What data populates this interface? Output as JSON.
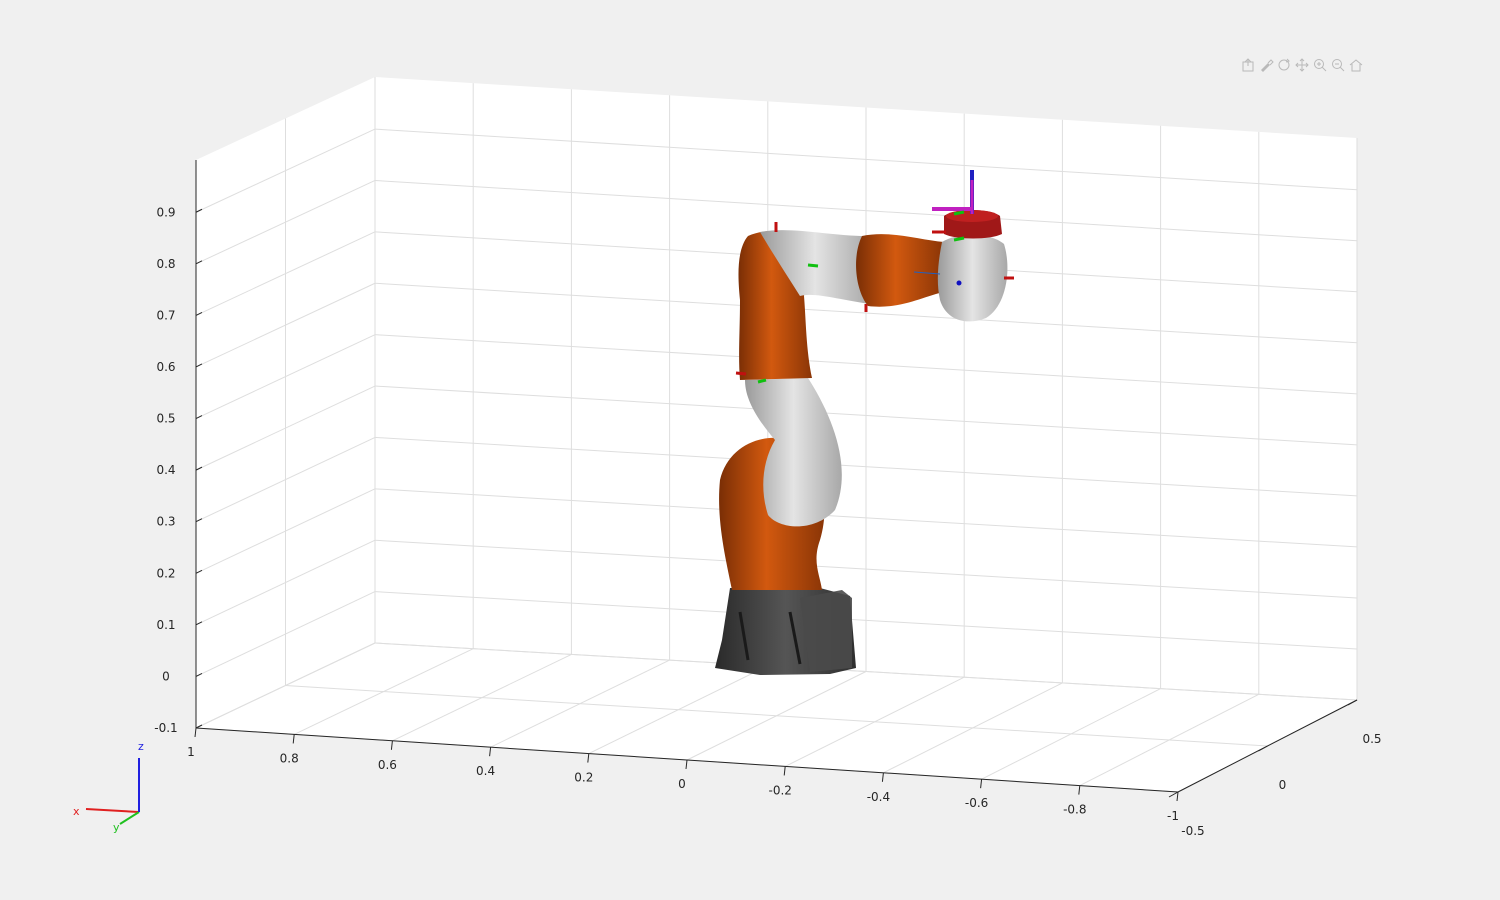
{
  "axes": {
    "x_ticks": [
      "1",
      "0.8",
      "0.6",
      "0.4",
      "0.2",
      "0",
      "-0.2",
      "-0.4",
      "-0.6",
      "-0.8",
      "-1"
    ],
    "y_ticks": [
      "0.5",
      "0",
      "-0.5"
    ],
    "z_ticks": [
      "0.9",
      "0.8",
      "0.7",
      "0.6",
      "0.5",
      "0.4",
      "0.3",
      "0.2",
      "0.1",
      "0",
      "-0.1"
    ],
    "grid": true,
    "background": "#ffffff",
    "grid_color": "#dedede"
  },
  "triad": {
    "x_label": "x",
    "y_label": "y",
    "z_label": "z"
  },
  "toolbar": {
    "icons": [
      "export-icon",
      "brush-icon",
      "rotate-icon",
      "pan-icon",
      "zoom-in-icon",
      "zoom-out-icon",
      "home-icon"
    ]
  },
  "colors": {
    "robot_orange": "#c2500e",
    "robot_gray": "#c8c8c8",
    "base_dark": "#3a3a3a",
    "axis_x": "#e02020",
    "axis_y": "#20c020",
    "axis_z": "#2020e0"
  }
}
